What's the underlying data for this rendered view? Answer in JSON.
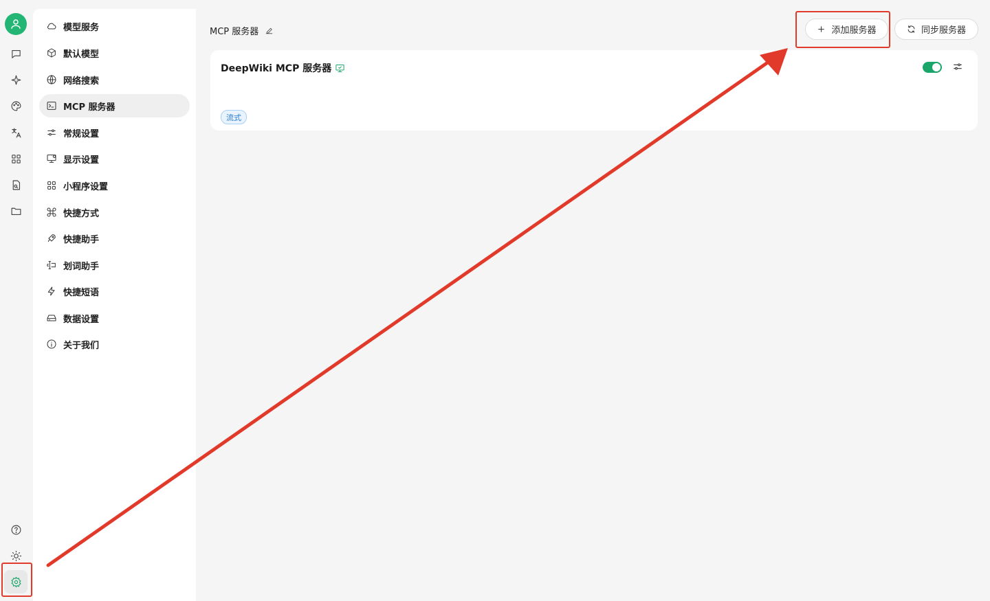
{
  "settings_menu": {
    "items": [
      {
        "label": "模型服务",
        "icon": "cloud-icon"
      },
      {
        "label": "默认模型",
        "icon": "cube-icon"
      },
      {
        "label": "网络搜索",
        "icon": "globe-icon"
      },
      {
        "label": "MCP 服务器",
        "icon": "terminal-icon"
      },
      {
        "label": "常规设置",
        "icon": "sliders-icon"
      },
      {
        "label": "显示设置",
        "icon": "monitor-icon"
      },
      {
        "label": "小程序设置",
        "icon": "grid-icon"
      },
      {
        "label": "快捷方式",
        "icon": "command-icon"
      },
      {
        "label": "快捷助手",
        "icon": "rocket-icon"
      },
      {
        "label": "划词助手",
        "icon": "text-cursor-icon"
      },
      {
        "label": "快捷短语",
        "icon": "zap-icon"
      },
      {
        "label": "数据设置",
        "icon": "hard-drive-icon"
      },
      {
        "label": "关于我们",
        "icon": "info-icon"
      }
    ],
    "active_item": "MCP 服务器"
  },
  "header": {
    "title": "MCP 服务器",
    "add_button": "添加服务器",
    "sync_button": "同步服务器"
  },
  "servers": [
    {
      "name": "DeepWiki MCP 服务器",
      "tag": "流式",
      "enabled": true
    }
  ],
  "colors": {
    "accent": "#1aa66a",
    "annotation": "#e23a2a",
    "tag_text": "#2a7bd4"
  }
}
